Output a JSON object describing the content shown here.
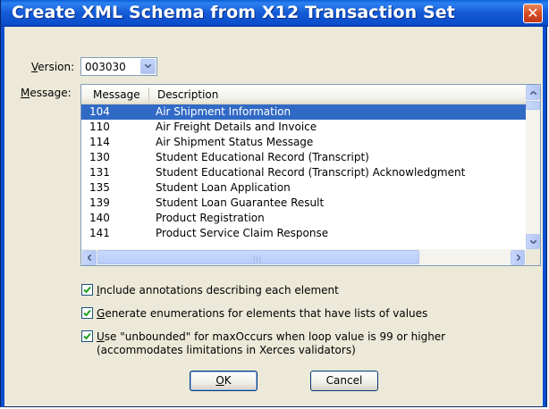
{
  "window": {
    "title": "Create XML Schema from X12 Transaction Set",
    "close_glyph": "✕"
  },
  "version": {
    "label_accel": "V",
    "label_rest": "ersion:",
    "value": "003030"
  },
  "message": {
    "label_accel": "M",
    "label_rest": "essage:",
    "columns": [
      "Message",
      "Description"
    ],
    "rows": [
      {
        "code": "104",
        "description": "Air Shipment Information",
        "selected": true
      },
      {
        "code": "110",
        "description": "Air Freight Details and Invoice",
        "selected": false
      },
      {
        "code": "114",
        "description": "Air Shipment Status Message",
        "selected": false
      },
      {
        "code": "130",
        "description": "Student Educational Record (Transcript)",
        "selected": false
      },
      {
        "code": "131",
        "description": "Student Educational Record (Transcript) Acknowledgment",
        "selected": false
      },
      {
        "code": "135",
        "description": "Student Loan Application",
        "selected": false
      },
      {
        "code": "139",
        "description": "Student Loan Guarantee Result",
        "selected": false
      },
      {
        "code": "140",
        "description": "Product Registration",
        "selected": false
      },
      {
        "code": "141",
        "description": "Product Service Claim Response",
        "selected": false
      }
    ]
  },
  "options": {
    "annotations": {
      "accel": "I",
      "rest": "nclude annotations describing each element",
      "checked": true
    },
    "enumerations": {
      "accel": "G",
      "rest": "enerate enumerations for elements that have lists of values",
      "checked": true
    },
    "unbounded": {
      "accel": "U",
      "rest": "se \"unbounded\" for maxOccurs when loop value is 99 or higher",
      "line2": "(accommodates limitations in Xerces validators)",
      "checked": true
    }
  },
  "buttons": {
    "ok": "OK",
    "ok_accel": "O",
    "ok_rest": "K",
    "cancel": "Cancel"
  },
  "colors": {
    "title_bar": "#0b4fcc",
    "selection": "#316ac5",
    "dialog_bg": "#ece9d8"
  }
}
